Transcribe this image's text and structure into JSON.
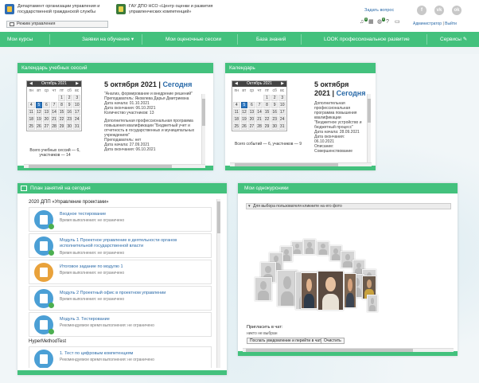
{
  "header": {
    "org_name": "Департамент организации управления и государственной гражданской службы",
    "org2_name": "ГАУ ДПО НСО «Центр оценки и развития управленческих компетенций»",
    "mode_button": "Режим управления",
    "ask_link": "Задать вопрос",
    "socials": [
      "f",
      "vk",
      "ok"
    ],
    "notification_count": "0",
    "messages_count": "0",
    "user_name": "Администратор",
    "logout": "Выйти"
  },
  "nav": {
    "items": [
      "Мои курсы",
      "Заявки на обучение",
      "Мои оценочные сессии",
      "База знаний",
      "LOOK профессиональное развитие",
      "Сервисы"
    ]
  },
  "training_calendar": {
    "title": "Календарь учебных сессий",
    "month_label": "Октябрь 2021",
    "weekdays": [
      "пн",
      "вт",
      "ср",
      "чт",
      "пт",
      "сб",
      "вс"
    ],
    "weeks": [
      [
        "",
        "",
        "",
        "",
        "1",
        "2",
        "3"
      ],
      [
        "4",
        "5",
        "6",
        "7",
        "8",
        "9",
        "10"
      ],
      [
        "11",
        "12",
        "13",
        "14",
        "15",
        "16",
        "17"
      ],
      [
        "18",
        "19",
        "20",
        "21",
        "22",
        "23",
        "24"
      ],
      [
        "25",
        "26",
        "27",
        "28",
        "29",
        "30",
        "31"
      ]
    ],
    "selected_day": "5",
    "date_title": "5 октября 2021",
    "today_label": "Сегодня",
    "info": [
      "\"Анализ, формирование и внедрение решений\"",
      "Преподаватель: Яковлева Дарья Дмитриевна",
      "Дата начала: 01.10.2021",
      "Дата окончания: 06.10.2021",
      "Количество участников: 13",
      "",
      "Дополнительная профессиональная программа повышения квалификации \"Бюджетный учет и отчетность в государственных и муниципальных учреждениях\"",
      "Преподаватель: нет",
      "Дата начала: 27.09.2021",
      "Дата окончания: 06.10.2021"
    ],
    "totals_line1": "Всего учебных сессий — 6,",
    "totals_line2": "участников — 14"
  },
  "calendar": {
    "title": "Календарь",
    "month_label": "Октябрь 2021",
    "date_title_line1": "5 октября",
    "date_title_line2": "2021",
    "today_label": "Сегодня",
    "info": [
      "Дополнительная",
      "профессиональная",
      "программа повышения",
      "квалификации",
      "\"Бюджетное устройство и",
      "бюджетный процесс\"",
      "Дата начала: 28.09.2021",
      "Дата окончания:",
      "06.10.2021",
      "Описание:",
      "Совершенствование"
    ],
    "totals": "Всего событий — 6, участников — 9"
  },
  "lesson_plan": {
    "title": "План занятий на сегодня",
    "groups": [
      {
        "name": "2020 ДПП «Управление проектами»",
        "lessons": [
          {
            "title": "Входное тестирование",
            "status": "Время выполнения: не ограничено"
          },
          {
            "title": "Модуль 1 Проектное управление в деятельности органов исполнительной государственной власти",
            "status": "Время выполнения: не ограничено"
          },
          {
            "title": "Итоговое задание по модулю 1",
            "status": "Время выполнения: не ограничено"
          },
          {
            "title": "Модуль 2 Проектный офис в проектном управлении",
            "status": "Время выполнения: не ограничено"
          },
          {
            "title": "Модуль 3. Тестирование",
            "status": "Рекомендуемое время выполнения: не ограничено"
          }
        ]
      },
      {
        "name": "HyperMethodTest",
        "lessons": [
          {
            "title": "1. Тест по цифровым компетенциям",
            "status": "Рекомендуемое время выполнения: не ограничено"
          }
        ]
      }
    ]
  },
  "classmates": {
    "title": "Мои однокурсники",
    "dropdown": "Для выбора пользователя кликните на его фото",
    "invite_label": "Пригласить в чат:",
    "no_one": "никто не выбран",
    "send_button": "Послать уведомление и перейти в чат",
    "clear_button": "Очистить"
  }
}
